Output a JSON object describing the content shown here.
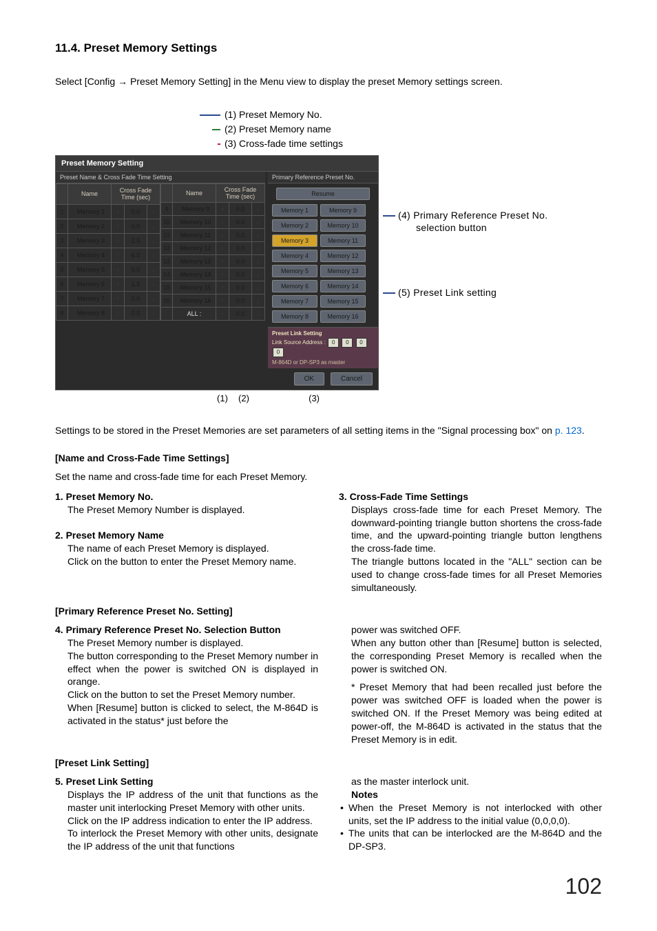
{
  "title": "11.4. Preset Memory Settings",
  "intro": "Select [Config → Preset Memory Setting] in the Menu view to display the preset Memory settings screen.",
  "legend": {
    "l1": "(1) Preset Memory No.",
    "l2": "(2) Preset Memory name",
    "l3": "(3) Cross-fade time settings"
  },
  "panel": {
    "title": "Preset Memory Setting",
    "subhead": "Preset Name & Cross Fade Time Setting",
    "col_name": "Name",
    "col_cft": "Cross Fade Time (sec)",
    "all_label": "ALL :",
    "all_val": "0.0",
    "left": [
      {
        "no": "1",
        "name": "Memory 1",
        "val": "0.0"
      },
      {
        "no": "2",
        "name": "Memory 2",
        "val": "0.0"
      },
      {
        "no": "3",
        "name": "Memory 3",
        "val": "2.5"
      },
      {
        "no": "4",
        "name": "Memory 4",
        "val": "6.0"
      },
      {
        "no": "5",
        "name": "Memory 5",
        "val": "0.0"
      },
      {
        "no": "6",
        "name": "Memory 6",
        "val": "1.5"
      },
      {
        "no": "7",
        "name": "Memory 7",
        "val": "0.0"
      },
      {
        "no": "8",
        "name": "Memory 8",
        "val": "0.0"
      }
    ],
    "right": [
      {
        "no": "9",
        "name": "Memory 9",
        "val": "0.0"
      },
      {
        "no": "10",
        "name": "Memory 10",
        "val": "0.0"
      },
      {
        "no": "11",
        "name": "Memory 11",
        "val": "0.0"
      },
      {
        "no": "12",
        "name": "Memory 12",
        "val": "0.0"
      },
      {
        "no": "13",
        "name": "Memory 13",
        "val": "0.0"
      },
      {
        "no": "14",
        "name": "Memory 14",
        "val": "0.0"
      },
      {
        "no": "15",
        "name": "Memory 15",
        "val": "0.0"
      },
      {
        "no": "16",
        "name": "Memory 16",
        "val": "0.0"
      }
    ],
    "primary": {
      "title": "Primary Reference Preset No.",
      "resume": "Resume",
      "active": "Memory 3",
      "buttons_left": [
        "Memory 1",
        "Memory 2",
        "Memory 3",
        "Memory 4",
        "Memory 5",
        "Memory 6",
        "Memory 7",
        "Memory 8"
      ],
      "buttons_right": [
        "Memory 9",
        "Memory 10",
        "Memory 11",
        "Memory 12",
        "Memory 13",
        "Memory 14",
        "Memory 15",
        "Memory 16"
      ]
    },
    "link": {
      "title": "Preset Link Setting",
      "label": "Link Source Address :",
      "ip": [
        "0",
        "0",
        "0",
        "0"
      ],
      "note": "M-864D or DP-SP3 as master"
    },
    "ok": "OK",
    "cancel": "Cancel"
  },
  "side": {
    "c4a": "(4) Primary  Reference  Preset  No.",
    "c4b": "selection button",
    "c5": "(5) Preset Link setting"
  },
  "markers": {
    "m1": "(1)",
    "m2": "(2)",
    "m3": "(3)"
  },
  "para1a": "Settings to be stored in the Preset Memories are set parameters of all setting items in the \"Signal processing box\" on ",
  "para1link": "p. 123",
  "para1b": ".",
  "h_name": "[Name and Cross-Fade Time Settings]",
  "p_name": "Set the name and cross-fade time for each Preset Memory.",
  "i1t": "1. Preset Memory No.",
  "i1b": "The Preset Memory Number is displayed.",
  "i2t": "2. Preset Memory Name",
  "i2b1": "The name of each Preset Memory is displayed.",
  "i2b2": "Click on the button to enter the Preset Memory name.",
  "i3t": "3. Cross-Fade Time Settings",
  "i3b1": "Displays cross-fade time for each Preset Memory. The downward-pointing triangle button shortens the cross-fade time, and the upward-pointing triangle button lengthens the cross-fade time.",
  "i3b2": "The triangle buttons located in the \"ALL\" section can be used to change cross-fade times for all Preset Memories simultaneously.",
  "h_primary": "[Primary Reference Preset No. Setting]",
  "i4t": "4. Primary Reference Preset No. Selection Button",
  "i4b1": "The Preset Memory number is displayed.",
  "i4b2": "The button corresponding to the Preset Memory number in effect when the power is switched ON is displayed in orange.",
  "i4b3": "Click on the button to set the Preset Memory number.",
  "i4b4": "When [Resume] button is clicked to select, the M-864D is activated in the status* just before the",
  "i4r1": "power was switched OFF.",
  "i4r2": "When any button other than [Resume] button is selected, the corresponding Preset Memory is recalled when the power is switched ON.",
  "i4star": "*  Preset Memory that had been recalled just before the power was switched OFF is loaded when the power is switched ON. If the Preset Memory was being edited at power-off, the M-864D is activated in the status that the Preset Memory is in edit.",
  "h_link": "[Preset Link Setting]",
  "i5t": "5. Preset Link Setting",
  "i5b1": "Displays the IP address of the unit that functions as the master unit interlocking Preset Memory with other units.",
  "i5b2": "Click on the IP address indication to enter the IP address.",
  "i5b3": "To interlock the Preset Memory with other units, designate the IP address of the unit that functions",
  "i5r1": "as the master interlock unit.",
  "notes": "Notes",
  "n1": "When the Preset Memory is not interlocked with other units, set the IP address to the initial value (0,0,0,0).",
  "n2": "The units that can be interlocked are the M-864D and the DP-SP3.",
  "pagenum": "102"
}
